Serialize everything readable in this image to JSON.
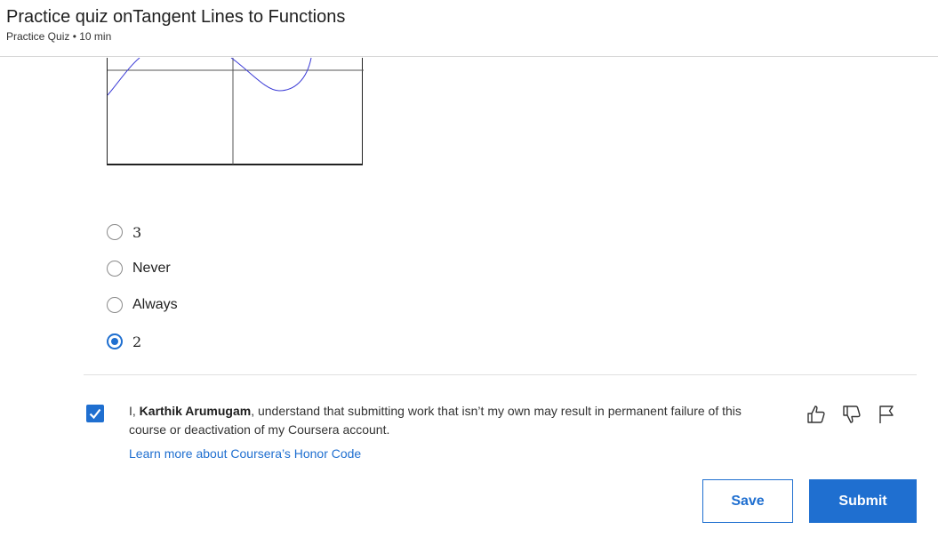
{
  "header": {
    "title": "Practice quiz onTangent Lines to Functions",
    "subtitle": "Practice Quiz • 10 min"
  },
  "graph": {
    "curve_color": "#3b3bd6",
    "axis_color": "#555555"
  },
  "question": {
    "options": [
      {
        "label": "3",
        "selected": false
      },
      {
        "label": "Never",
        "selected": false
      },
      {
        "label": "Always",
        "selected": false
      },
      {
        "label": "2",
        "selected": true
      }
    ]
  },
  "honor_code": {
    "checked": true,
    "prefix": "I, ",
    "name": "Karthik Arumugam",
    "text": ", understand that submitting work that isn’t my own may result in permanent failure of this course or deactivation of my Coursera account.",
    "link": "Learn more about Coursera’s Honor Code"
  },
  "feedback": {
    "like_icon": "thumbs-up-icon",
    "dislike_icon": "thumbs-down-icon",
    "flag_icon": "flag-icon"
  },
  "actions": {
    "save_label": "Save",
    "submit_label": "Submit"
  },
  "colors": {
    "accent": "#1f6fd0",
    "divider": "#e0e0e0"
  }
}
